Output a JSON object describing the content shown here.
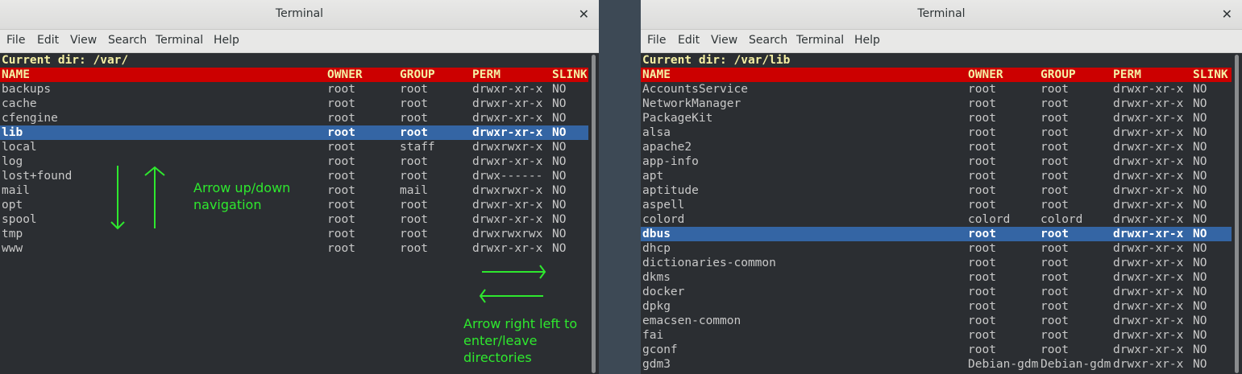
{
  "left": {
    "title": "Terminal",
    "menu": [
      "File",
      "Edit",
      "View",
      "Search",
      "Terminal",
      "Help"
    ],
    "current_dir": "Current dir: /var/",
    "columns": [
      "NAME",
      "OWNER",
      "GROUP",
      "PERM",
      "SLINK"
    ],
    "rows": [
      [
        "backups",
        "root",
        "root",
        "drwxr-xr-x",
        "NO"
      ],
      [
        "cache",
        "root",
        "root",
        "drwxr-xr-x",
        "NO"
      ],
      [
        "cfengine",
        "root",
        "root",
        "drwxr-xr-x",
        "NO"
      ],
      [
        "lib",
        "root",
        "root",
        "drwxr-xr-x",
        "NO"
      ],
      [
        "local",
        "root",
        "staff",
        "drwxrwxr-x",
        "NO"
      ],
      [
        "log",
        "root",
        "root",
        "drwxr-xr-x",
        "NO"
      ],
      [
        "lost+found",
        "root",
        "root",
        "drwx------",
        "NO"
      ],
      [
        "mail",
        "root",
        "mail",
        "drwxrwxr-x",
        "NO"
      ],
      [
        "opt",
        "root",
        "root",
        "drwxr-xr-x",
        "NO"
      ],
      [
        "spool",
        "root",
        "root",
        "drwxr-xr-x",
        "NO"
      ],
      [
        "tmp",
        "root",
        "root",
        "drwxrwxrwx",
        "NO"
      ],
      [
        "www",
        "root",
        "root",
        "drwxr-xr-x",
        "NO"
      ]
    ],
    "selected_index": 3
  },
  "right": {
    "title": "Terminal",
    "menu": [
      "File",
      "Edit",
      "View",
      "Search",
      "Terminal",
      "Help"
    ],
    "current_dir": "Current dir: /var/lib",
    "columns": [
      "NAME",
      "OWNER",
      "GROUP",
      "PERM",
      "SLINK"
    ],
    "rows": [
      [
        "AccountsService",
        "root",
        "root",
        "drwxr-xr-x",
        "NO"
      ],
      [
        "NetworkManager",
        "root",
        "root",
        "drwxr-xr-x",
        "NO"
      ],
      [
        "PackageKit",
        "root",
        "root",
        "drwxr-xr-x",
        "NO"
      ],
      [
        "alsa",
        "root",
        "root",
        "drwxr-xr-x",
        "NO"
      ],
      [
        "apache2",
        "root",
        "root",
        "drwxr-xr-x",
        "NO"
      ],
      [
        "app-info",
        "root",
        "root",
        "drwxr-xr-x",
        "NO"
      ],
      [
        "apt",
        "root",
        "root",
        "drwxr-xr-x",
        "NO"
      ],
      [
        "aptitude",
        "root",
        "root",
        "drwxr-xr-x",
        "NO"
      ],
      [
        "aspell",
        "root",
        "root",
        "drwxr-xr-x",
        "NO"
      ],
      [
        "colord",
        "colord",
        "colord",
        "drwxr-xr-x",
        "NO"
      ],
      [
        "dbus",
        "root",
        "root",
        "drwxr-xr-x",
        "NO"
      ],
      [
        "dhcp",
        "root",
        "root",
        "drwxr-xr-x",
        "NO"
      ],
      [
        "dictionaries-common",
        "root",
        "root",
        "drwxr-xr-x",
        "NO"
      ],
      [
        "dkms",
        "root",
        "root",
        "drwxr-xr-x",
        "NO"
      ],
      [
        "docker",
        "root",
        "root",
        "drwxr-xr-x",
        "NO"
      ],
      [
        "dpkg",
        "root",
        "root",
        "drwxr-xr-x",
        "NO"
      ],
      [
        "emacsen-common",
        "root",
        "root",
        "drwxr-xr-x",
        "NO"
      ],
      [
        "fai",
        "root",
        "root",
        "drwxr-xr-x",
        "NO"
      ],
      [
        "gconf",
        "root",
        "root",
        "drwxr-xr-x",
        "NO"
      ],
      [
        "gdm3",
        "Debian-gdm",
        "Debian-gdm",
        "drwxr-xr-x",
        "NO"
      ]
    ],
    "selected_index": 10
  },
  "annotations": {
    "updown": [
      "Arrow up/down",
      "navigation"
    ],
    "rightleft": [
      "Arrow right left to",
      "enter/leave directories"
    ]
  },
  "colors": {
    "header_bg": "#cc0000",
    "header_text": "#f5f0a4",
    "selection": "#3465a4",
    "annotation": "#2ee82e"
  }
}
